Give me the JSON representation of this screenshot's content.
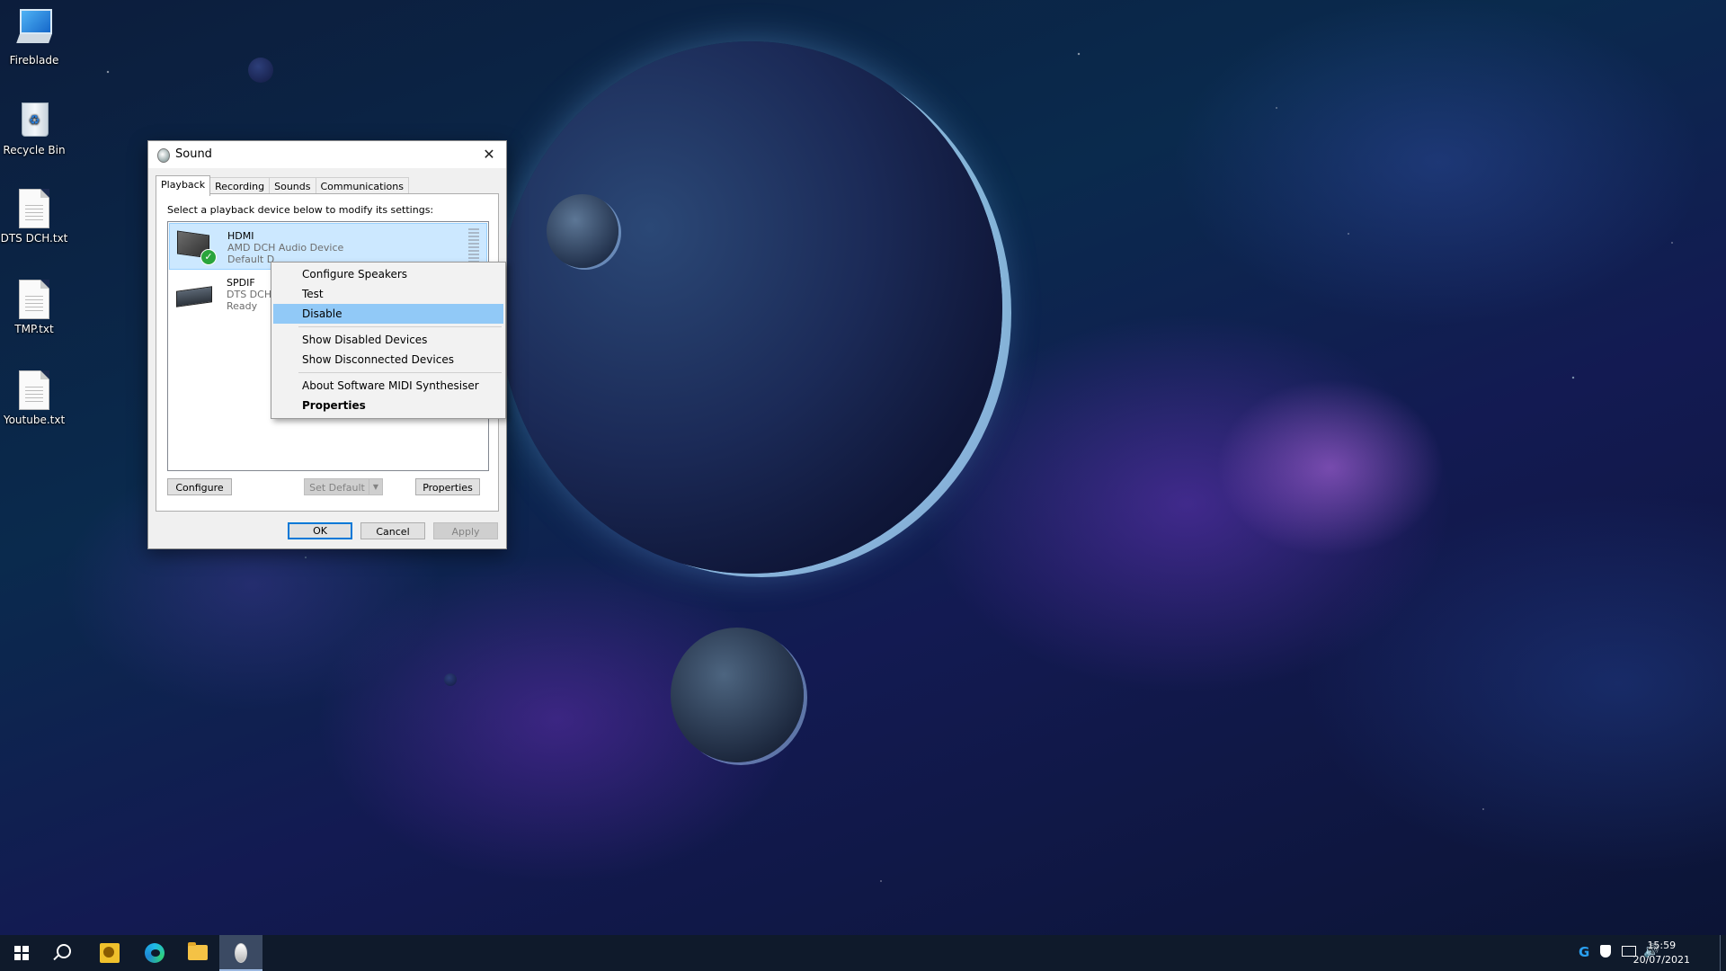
{
  "desktop": {
    "icons": [
      {
        "label": "Fireblade",
        "icon": "computer-icon"
      },
      {
        "label": "Recycle Bin",
        "icon": "recycle-bin-icon"
      },
      {
        "label": "DTS DCH.txt",
        "icon": "text-file-icon"
      },
      {
        "label": "TMP.txt",
        "icon": "text-file-icon"
      },
      {
        "label": "Youtube.txt",
        "icon": "text-file-icon"
      }
    ]
  },
  "sound_dialog": {
    "title": "Sound",
    "tabs": [
      "Playback",
      "Recording",
      "Sounds",
      "Communications"
    ],
    "active_tab": "Playback",
    "instruction": "Select a playback device below to modify its settings:",
    "devices": [
      {
        "name": "HDMI",
        "driver": "AMD DCH Audio Device",
        "status": "Default D",
        "selected": true,
        "default": true
      },
      {
        "name": "SPDIF",
        "driver": "DTS DCH",
        "status": "Ready",
        "selected": false,
        "default": false
      }
    ],
    "buttons": {
      "configure": "Configure",
      "set_default": "Set Default",
      "properties": "Properties",
      "ok": "OK",
      "cancel": "Cancel",
      "apply": "Apply"
    }
  },
  "context_menu": {
    "items": [
      {
        "label": "Configure Speakers"
      },
      {
        "label": "Test"
      },
      {
        "label": "Disable",
        "highlighted": true
      },
      {
        "label": "Show Disabled Devices"
      },
      {
        "label": "Show Disconnected Devices"
      },
      {
        "label": "About Software MIDI Synthesiser"
      },
      {
        "label": "Properties",
        "bold": true
      }
    ]
  },
  "taskbar": {
    "apps": [
      "start-icon",
      "search-icon",
      "yellow-app-icon",
      "edge-icon",
      "file-explorer-icon",
      "sound-app-icon"
    ],
    "tray_icons": [
      "g-app-icon",
      "defender-icon",
      "network-icon",
      "volume-icon"
    ],
    "time": "15:59",
    "date": "20/07/2021"
  },
  "colors": {
    "selection_blue": "#cce8ff",
    "menu_highlight": "#91c9f7",
    "taskbar": "#0f1a2b",
    "default_button_border": "#0078d7"
  }
}
